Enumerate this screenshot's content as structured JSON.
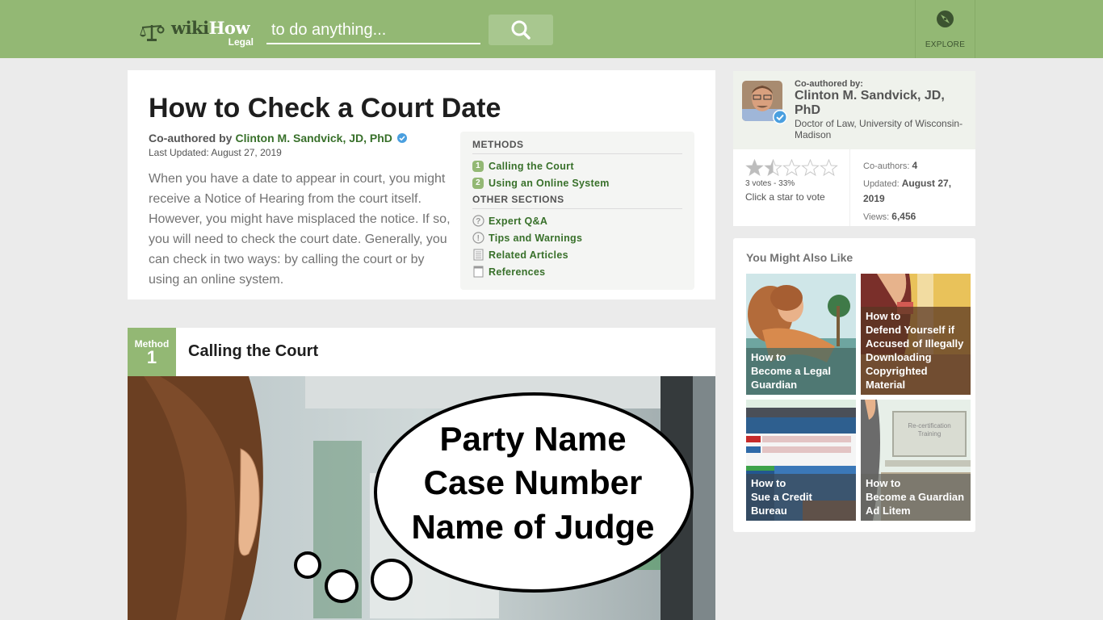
{
  "header": {
    "logo_main": "wiki",
    "logo_accent": "How",
    "logo_sub": "Legal",
    "search_placeholder": "to do anything...",
    "search_icon": "search-icon",
    "explore_label": "EXPLORE",
    "explore_icon": "compass-icon",
    "brand_color": "#93b874"
  },
  "article": {
    "title": "How to Check a Court Date",
    "coauthored_prefix": "Co-authored by",
    "author": "Clinton M. Sandvick, JD, PhD",
    "last_updated": "Last Updated: August 27, 2019",
    "intro": "When you have a date to appear in court, you might receive a Notice of Hearing from the court itself. However, you might have misplaced the notice. If so, you will need to check the court date. Generally, you can check in two ways: by calling the court or by using an online system."
  },
  "toc": {
    "methods_heading": "METHODS",
    "methods": [
      {
        "num": "1",
        "label": "Calling the Court"
      },
      {
        "num": "2",
        "label": "Using an Online System"
      }
    ],
    "other_heading": "OTHER SECTIONS",
    "other": [
      {
        "icon": "question-circle-icon",
        "label": "Expert Q&A"
      },
      {
        "icon": "exclamation-circle-icon",
        "label": "Tips and Warnings"
      },
      {
        "icon": "document-icon",
        "label": "Related Articles"
      },
      {
        "icon": "book-icon",
        "label": "References"
      }
    ]
  },
  "method": {
    "badge_label": "Method",
    "badge_num": "1",
    "title": "Calling the Court",
    "image_bubble_lines": [
      "Party Name",
      "Case Number",
      "Name of Judge"
    ]
  },
  "sidebar": {
    "coauthor_label": "Co-authored by:",
    "coauthor_name": "Clinton M. Sandvick, JD, PhD",
    "coauthor_desc": "Doctor of Law, University of Wisconsin-Madison",
    "rating": {
      "stars_filled": 1.5,
      "stars_total": 5,
      "votes_text": "3 votes - 33%",
      "cta": "Click a star to vote"
    },
    "stats": {
      "coauthors_label": "Co-authors:",
      "coauthors_value": "4",
      "updated_label": "Updated:",
      "updated_value": "August 27, 2019",
      "views_label": "Views:",
      "views_value": "6,456"
    },
    "related_heading": "You Might Also Like",
    "related": [
      {
        "prefix": "How to",
        "title": "Become a Legal Guardian"
      },
      {
        "prefix": "How to",
        "title": "Defend Yourself if Accused of Illegally Downloading Copyrighted Material"
      },
      {
        "prefix": "How to",
        "title": "Sue a Credit Bureau"
      },
      {
        "prefix": "How to",
        "title": "Become a Guardian Ad Litem"
      }
    ]
  }
}
